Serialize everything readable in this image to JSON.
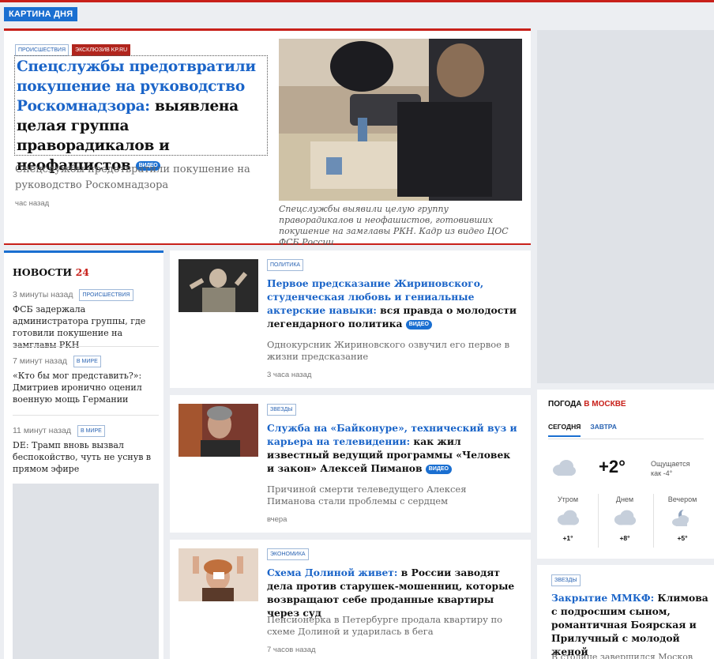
{
  "section_label": "КАРТИНА ДНЯ",
  "hero": {
    "tags": [
      "ПРОИСШЕСТВИЯ",
      "ЭКСКЛЮЗИВ KP.RU"
    ],
    "title_highlight": "Спецслужбы предотвратили покушение на руководство Роскомнадзора:",
    "title_rest": " выявлена целая группа праворадикалов и неофашистов",
    "video_label": "ВИДЕО",
    "lead": "Спецслужбы предотвратили покушение на руководство Роскомнадзора",
    "time": "час назад",
    "caption": "Спецслужбы выявили целую группу праворадикалов и неофашистов, готовивших покушение на замглавы РКН. Кадр из видео ЦОС ФСБ России"
  },
  "news24": {
    "title": "НОВОСТИ",
    "title_num": "24",
    "items": [
      {
        "time": "3 минуты назад",
        "tag": "ПРОИСШЕСТВИЯ",
        "text": "ФСБ задержала администратора группы, где готовили покушение на замглавы РКН"
      },
      {
        "time": "7 минут назад",
        "tag": "В МИРЕ",
        "text": "«Кто бы мог представить?»: Дмитриев иронично оценил военную мощь Германии"
      },
      {
        "time": "11 минут назад",
        "tag": "В МИРЕ",
        "text": "DE: Трамп вновь вызвал беспокойство, чуть не уснув в прямом эфире"
      }
    ]
  },
  "cards": [
    {
      "tag": "ПОЛИТИКА",
      "title_highlight": "Первое предсказание Жириновского, студенческая любовь и гениальные актерские навыки:",
      "title_rest": " вся правда о молодости легендарного политика",
      "video": "ВИДЕО",
      "lead": "Однокурсник Жириновского озвучил его первое в жизни предсказание",
      "time": "3 часа назад"
    },
    {
      "tag": "ЗВЕЗДЫ",
      "title_highlight": "Служба на «Байконуре», технический вуз и карьера на телевидении:",
      "title_rest": " как жил известный ведущий программы «Человек и закон» Алексей Пиманов",
      "video": "ВИДЕО",
      "lead": "Причиной смерти телеведущего Алексея Пиманова стали проблемы с сердцем",
      "time": "вчера"
    },
    {
      "tag": "ЭКОНОМИКА",
      "title_highlight": "Схема Долиной живет:",
      "title_rest": " в России заводят дела против старушек-мошенниц, которые возвращают себе проданные квартиры через суд",
      "video": "",
      "lead": "Пенсионерка в Петербурге продала квартиру по схеме Долиной и ударилась в бега",
      "time": "7 часов назад"
    }
  ],
  "weather": {
    "title": "ПОГОДА",
    "city": "В МОСКВЕ",
    "tabs": [
      "СЕГОДНЯ",
      "ЗАВТРА"
    ],
    "now_temp": "+2°",
    "feels_line1": "Ощущается",
    "feels_line2": "как -4°",
    "parts": [
      {
        "label": "Утром",
        "temp": "+1°",
        "icon": "cloud-icon"
      },
      {
        "label": "Днем",
        "temp": "+8°",
        "icon": "cloud-icon"
      },
      {
        "label": "Вечером",
        "temp": "+5°",
        "icon": "moon-cloud-icon"
      }
    ]
  },
  "side_card": {
    "tag": "ЗВЕЗДЫ",
    "title_highlight": "Закрытие ММКФ:",
    "title_rest": " Климова с подросшим сыном, романтичная Боярская и Прилучный с молодой женой",
    "lead": "В столице завершился Москов"
  },
  "colors": {
    "accent_blue": "#1a6fd1",
    "accent_red": "#c8201a"
  }
}
